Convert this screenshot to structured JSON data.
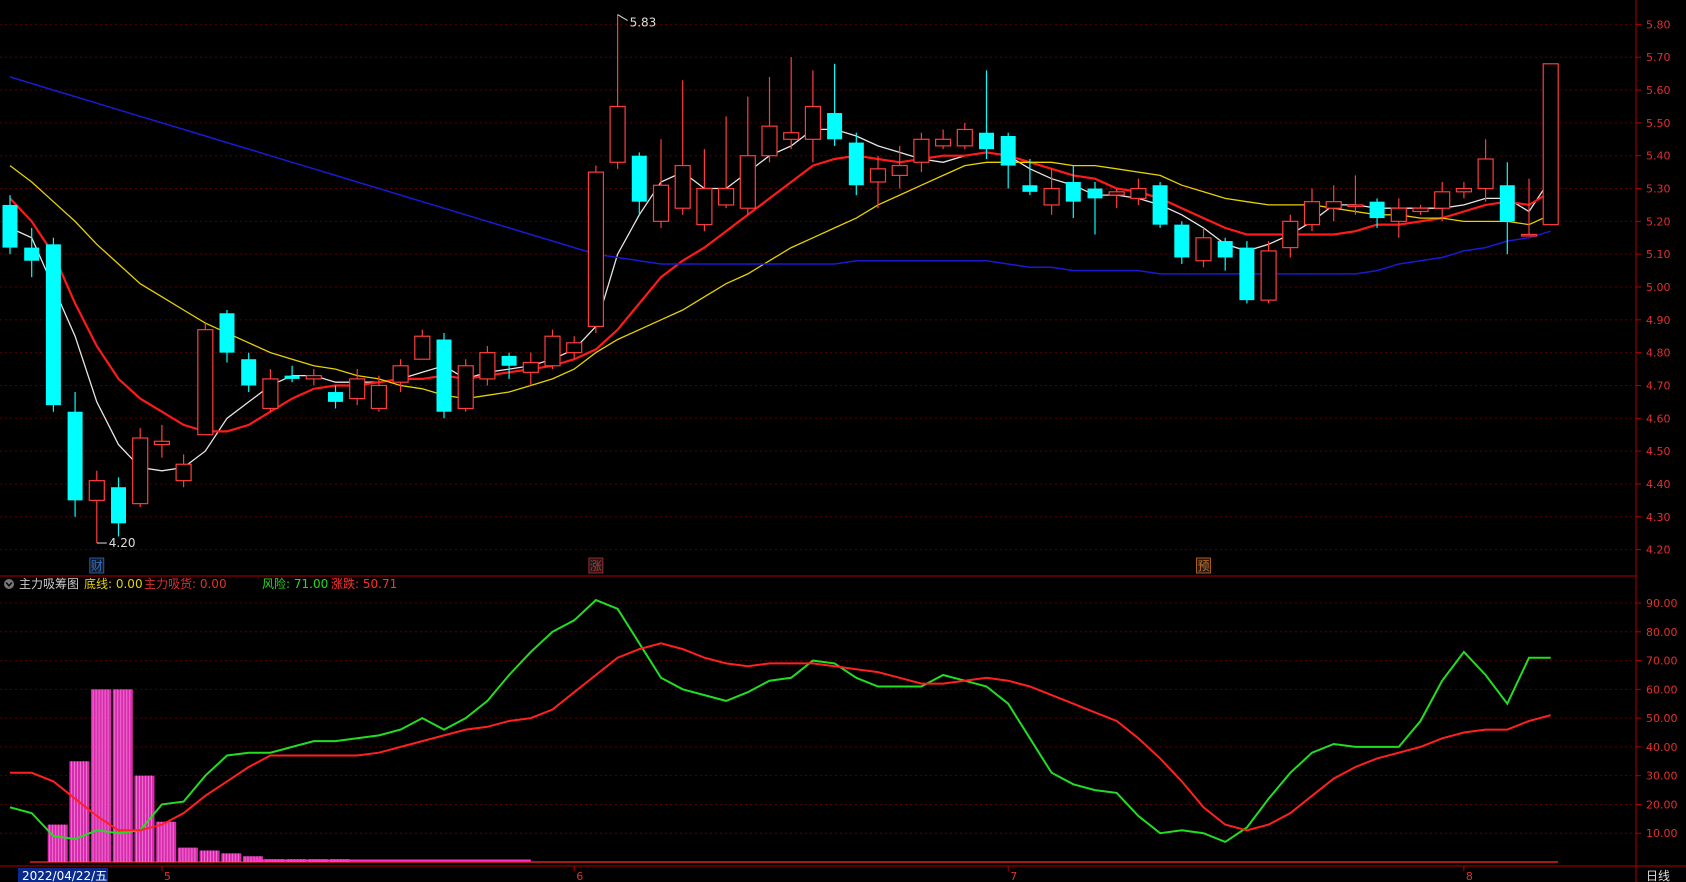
{
  "window_title": "",
  "bottom_label": "日线",
  "colors": {
    "bg": "#000000",
    "up": "#ff3c3c",
    "down": "#00ffff",
    "grid": "#5a0000",
    "axis": "#b00000",
    "ma_white": "#e6e6e6",
    "ma_red": "#ff1a1a",
    "ma_yellow": "#e6d200",
    "ma_blue": "#1a1ad2",
    "osc_green": "#22dd22",
    "osc_red": "#ff2020",
    "hist": "#ff33cc"
  },
  "chart_data": [
    {
      "type": "candlestick",
      "title": "",
      "ylim": [
        4.15,
        5.85
      ],
      "yticks": [
        "4.20",
        "4.30",
        "4.40",
        "4.50",
        "4.60",
        "4.70",
        "4.80",
        "4.90",
        "5.00",
        "5.10",
        "5.20",
        "5.30",
        "5.40",
        "5.50",
        "5.60",
        "5.70",
        "5.80"
      ],
      "x_labels": [
        "5",
        "6",
        "7",
        "8"
      ],
      "x_label_index": [
        7,
        26,
        46,
        67
      ],
      "hi_label": "5.83",
      "hi_index": 28,
      "lo_label": "4.20",
      "lo_index": 4,
      "markers": [
        {
          "index": 4,
          "text": "财",
          "color": "#2a6fd6"
        },
        {
          "index": 27,
          "text": "涨",
          "color": "#c03030"
        },
        {
          "index": 55,
          "text": "预",
          "color": "#d07020"
        }
      ],
      "candles": [
        [
          5.25,
          5.12,
          5.28,
          5.1
        ],
        [
          5.12,
          5.08,
          5.18,
          5.03
        ],
        [
          5.13,
          4.64,
          5.15,
          4.62
        ],
        [
          4.62,
          4.35,
          4.68,
          4.3
        ],
        [
          4.35,
          4.41,
          4.44,
          4.22
        ],
        [
          4.39,
          4.28,
          4.42,
          4.24
        ],
        [
          4.34,
          4.54,
          4.57,
          4.33
        ],
        [
          4.52,
          4.53,
          4.58,
          4.48
        ],
        [
          4.41,
          4.46,
          4.49,
          4.39
        ],
        [
          4.55,
          4.87,
          4.89,
          4.56
        ],
        [
          4.92,
          4.8,
          4.93,
          4.77
        ],
        [
          4.78,
          4.7,
          4.8,
          4.68
        ],
        [
          4.63,
          4.72,
          4.75,
          4.62
        ],
        [
          4.73,
          4.72,
          4.76,
          4.71
        ],
        [
          4.72,
          4.73,
          4.75,
          4.7
        ],
        [
          4.68,
          4.65,
          4.7,
          4.63
        ],
        [
          4.66,
          4.72,
          4.75,
          4.64
        ],
        [
          4.63,
          4.7,
          4.73,
          4.62
        ],
        [
          4.71,
          4.76,
          4.78,
          4.68
        ],
        [
          4.78,
          4.85,
          4.87,
          4.78
        ],
        [
          4.84,
          4.62,
          4.86,
          4.6
        ],
        [
          4.63,
          4.76,
          4.78,
          4.62
        ],
        [
          4.72,
          4.8,
          4.82,
          4.7
        ],
        [
          4.79,
          4.76,
          4.8,
          4.72
        ],
        [
          4.74,
          4.77,
          4.8,
          4.7
        ],
        [
          4.76,
          4.85,
          4.87,
          4.75
        ],
        [
          4.8,
          4.83,
          4.85,
          4.78
        ],
        [
          4.88,
          5.35,
          5.37,
          4.86
        ],
        [
          5.38,
          5.55,
          5.83,
          5.36
        ],
        [
          5.4,
          5.26,
          5.41,
          5.22
        ],
        [
          5.2,
          5.31,
          5.45,
          5.18
        ],
        [
          5.24,
          5.37,
          5.63,
          5.22
        ],
        [
          5.19,
          5.3,
          5.42,
          5.17
        ],
        [
          5.25,
          5.3,
          5.52,
          5.24
        ],
        [
          5.24,
          5.4,
          5.58,
          5.22
        ],
        [
          5.4,
          5.49,
          5.64,
          5.38
        ],
        [
          5.45,
          5.47,
          5.7,
          5.42
        ],
        [
          5.45,
          5.55,
          5.66,
          5.38
        ],
        [
          5.53,
          5.45,
          5.68,
          5.43
        ],
        [
          5.44,
          5.31,
          5.47,
          5.28
        ],
        [
          5.32,
          5.36,
          5.4,
          5.24
        ],
        [
          5.34,
          5.37,
          5.43,
          5.3
        ],
        [
          5.38,
          5.45,
          5.47,
          5.35
        ],
        [
          5.43,
          5.45,
          5.48,
          5.42
        ],
        [
          5.43,
          5.48,
          5.5,
          5.42
        ],
        [
          5.47,
          5.42,
          5.66,
          5.39
        ],
        [
          5.46,
          5.37,
          5.47,
          5.3
        ],
        [
          5.31,
          5.29,
          5.39,
          5.28
        ],
        [
          5.25,
          5.3,
          5.36,
          5.22
        ],
        [
          5.32,
          5.26,
          5.37,
          5.21
        ],
        [
          5.3,
          5.27,
          5.32,
          5.16
        ],
        [
          5.28,
          5.29,
          5.3,
          5.24
        ],
        [
          5.27,
          5.3,
          5.33,
          5.25
        ],
        [
          5.31,
          5.19,
          5.32,
          5.18
        ],
        [
          5.19,
          5.09,
          5.2,
          5.07
        ],
        [
          5.08,
          5.15,
          5.18,
          5.06
        ],
        [
          5.14,
          5.09,
          5.15,
          5.05
        ],
        [
          5.12,
          4.96,
          5.14,
          4.95
        ],
        [
          4.96,
          5.11,
          5.14,
          4.95
        ],
        [
          5.12,
          5.2,
          5.22,
          5.09
        ],
        [
          5.19,
          5.26,
          5.3,
          5.17
        ],
        [
          5.24,
          5.26,
          5.31,
          5.2
        ],
        [
          5.25,
          5.25,
          5.34,
          5.22
        ],
        [
          5.26,
          5.21,
          5.27,
          5.18
        ],
        [
          5.2,
          5.24,
          5.27,
          5.15
        ],
        [
          5.23,
          5.24,
          5.25,
          5.22
        ],
        [
          5.24,
          5.29,
          5.32,
          5.2
        ],
        [
          5.29,
          5.3,
          5.32,
          5.27
        ],
        [
          5.3,
          5.39,
          5.45,
          5.26
        ],
        [
          5.31,
          5.2,
          5.38,
          5.1
        ],
        [
          5.16,
          5.16,
          5.33,
          5.16
        ],
        [
          5.19,
          5.68,
          5.68,
          5.19
        ]
      ],
      "series": [
        {
          "key": "ma_white",
          "values": [
            5.18,
            5.15,
            5.0,
            4.85,
            4.65,
            4.52,
            4.45,
            4.44,
            4.45,
            4.5,
            4.6,
            4.65,
            4.7,
            4.73,
            4.73,
            4.71,
            4.71,
            4.71,
            4.72,
            4.74,
            4.76,
            4.72,
            4.74,
            4.75,
            4.76,
            4.78,
            4.81,
            4.88,
            5.1,
            5.22,
            5.32,
            5.35,
            5.3,
            5.3,
            5.35,
            5.4,
            5.43,
            5.48,
            5.48,
            5.46,
            5.43,
            5.41,
            5.39,
            5.38,
            5.4,
            5.41,
            5.4,
            5.36,
            5.33,
            5.31,
            5.28,
            5.28,
            5.27,
            5.25,
            5.22,
            5.18,
            5.13,
            5.11,
            5.13,
            5.16,
            5.2,
            5.25,
            5.25,
            5.24,
            5.24,
            5.24,
            5.24,
            5.25,
            5.27,
            5.27,
            5.23,
            5.33
          ]
        },
        {
          "key": "ma_red",
          "values": [
            5.27,
            5.2,
            5.1,
            4.95,
            4.82,
            4.72,
            4.66,
            4.62,
            4.58,
            4.56,
            4.56,
            4.58,
            4.62,
            4.66,
            4.69,
            4.7,
            4.7,
            4.71,
            4.72,
            4.72,
            4.73,
            4.72,
            4.73,
            4.74,
            4.75,
            4.76,
            4.78,
            4.81,
            4.87,
            4.95,
            5.03,
            5.08,
            5.12,
            5.17,
            5.22,
            5.27,
            5.32,
            5.37,
            5.39,
            5.4,
            5.39,
            5.38,
            5.39,
            5.4,
            5.4,
            5.41,
            5.4,
            5.38,
            5.36,
            5.34,
            5.33,
            5.3,
            5.29,
            5.27,
            5.24,
            5.21,
            5.18,
            5.16,
            5.16,
            5.16,
            5.16,
            5.16,
            5.17,
            5.19,
            5.19,
            5.2,
            5.21,
            5.23,
            5.25,
            5.26,
            5.25,
            5.29
          ]
        },
        {
          "key": "ma_yellow",
          "values": [
            5.37,
            5.32,
            5.26,
            5.2,
            5.13,
            5.07,
            5.01,
            4.97,
            4.93,
            4.89,
            4.86,
            4.83,
            4.8,
            4.78,
            4.76,
            4.75,
            4.73,
            4.72,
            4.7,
            4.69,
            4.67,
            4.66,
            4.67,
            4.68,
            4.7,
            4.72,
            4.75,
            4.8,
            4.84,
            4.87,
            4.9,
            4.93,
            4.97,
            5.01,
            5.04,
            5.08,
            5.12,
            5.15,
            5.18,
            5.21,
            5.25,
            5.28,
            5.31,
            5.34,
            5.37,
            5.38,
            5.38,
            5.38,
            5.38,
            5.37,
            5.37,
            5.36,
            5.35,
            5.34,
            5.31,
            5.29,
            5.27,
            5.26,
            5.25,
            5.25,
            5.25,
            5.24,
            5.23,
            5.22,
            5.22,
            5.21,
            5.21,
            5.2,
            5.2,
            5.2,
            5.19,
            5.22
          ]
        },
        {
          "key": "ma_blue",
          "values": [
            5.64,
            5.62,
            5.6,
            5.58,
            5.56,
            5.54,
            5.52,
            5.5,
            5.48,
            5.46,
            5.44,
            5.42,
            5.4,
            5.38,
            5.36,
            5.34,
            5.32,
            5.3,
            5.28,
            5.26,
            5.24,
            5.22,
            5.2,
            5.18,
            5.16,
            5.14,
            5.12,
            5.1,
            5.09,
            5.08,
            5.07,
            5.07,
            5.07,
            5.07,
            5.07,
            5.07,
            5.07,
            5.07,
            5.07,
            5.08,
            5.08,
            5.08,
            5.08,
            5.08,
            5.08,
            5.08,
            5.07,
            5.06,
            5.06,
            5.05,
            5.05,
            5.05,
            5.05,
            5.04,
            5.04,
            5.04,
            5.04,
            5.04,
            5.04,
            5.04,
            5.04,
            5.04,
            5.04,
            5.05,
            5.07,
            5.08,
            5.09,
            5.11,
            5.12,
            5.14,
            5.15,
            5.17
          ]
        }
      ]
    },
    {
      "type": "line",
      "title": "主力吸筹图",
      "legend": [
        {
          "label": "底线: 0.00",
          "color": "#e6d200"
        },
        {
          "label": "主力吸货: 0.00",
          "color": "#e03030"
        },
        {
          "label": "风险: 71.00",
          "color": "#22dd22"
        },
        {
          "label": "涨跌: 50.71",
          "color": "#ff3030"
        }
      ],
      "ylim": [
        0,
        98
      ],
      "yticks": [
        "10.00",
        "20.00",
        "30.00",
        "40.00",
        "50.00",
        "60.00",
        "70.00",
        "80.00",
        "90.00"
      ],
      "date_label": "2022/04/22/五",
      "series": [
        {
          "key": "osc_green",
          "values": [
            19,
            17,
            9,
            8,
            11,
            10,
            11,
            20,
            21,
            30,
            37,
            38,
            38,
            40,
            42,
            42,
            43,
            44,
            46,
            50,
            46,
            50,
            56,
            65,
            73,
            80,
            84,
            91,
            88,
            76,
            64,
            60,
            58,
            56,
            59,
            63,
            64,
            70,
            69,
            64,
            61,
            61,
            61,
            65,
            63,
            61,
            55,
            43,
            31,
            27,
            25,
            24,
            16,
            10,
            11,
            10,
            7,
            12,
            22,
            31,
            38,
            41,
            40,
            40,
            40,
            49,
            63,
            73,
            65,
            55,
            71,
            71
          ]
        },
        {
          "key": "osc_red",
          "values": [
            31,
            31,
            28,
            22,
            16,
            11,
            11,
            13,
            17,
            23,
            28,
            33,
            37,
            37,
            37,
            37,
            37,
            38,
            40,
            42,
            44,
            46,
            47,
            49,
            50,
            53,
            59,
            65,
            71,
            74,
            76,
            74,
            71,
            69,
            68,
            69,
            69,
            69,
            68,
            67,
            66,
            64,
            62,
            62,
            63,
            64,
            63,
            61,
            58,
            55,
            52,
            49,
            43,
            36,
            28,
            19,
            13,
            11,
            13,
            17,
            23,
            29,
            33,
            36,
            38,
            40,
            43,
            45,
            46,
            46,
            49,
            51
          ]
        },
        {
          "key": "hist",
          "values": [
            0,
            13,
            35,
            60,
            60,
            30,
            14,
            5,
            4,
            3,
            2,
            1,
            1,
            1,
            1,
            0,
            0,
            0,
            0,
            0,
            0,
            0,
            0,
            0
          ]
        }
      ]
    }
  ]
}
